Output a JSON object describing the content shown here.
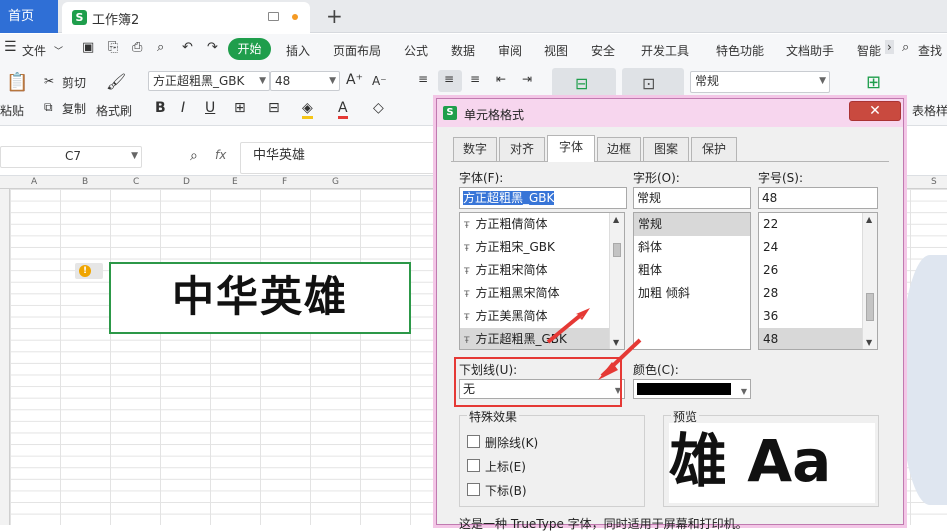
{
  "tabs": {
    "home": "首页",
    "doc": "工作簿2",
    "doc_icon": "S",
    "new": "+"
  },
  "menu": {
    "file": "文件",
    "start": "开始",
    "items": [
      "插入",
      "页面布局",
      "公式",
      "数据",
      "审阅",
      "视图",
      "安全",
      "开发工具",
      "特色功能",
      "文档助手",
      "智能"
    ],
    "search": "查找"
  },
  "ribbon": {
    "cut": "剪切",
    "copy": "复制",
    "paste": "粘贴",
    "format_painter": "格式刷",
    "font_name": "方正超粗黑_GBK",
    "font_size": "48",
    "bold": "B",
    "italic": "I",
    "underline": "U",
    "number_format": "常规",
    "table_style": "表格样"
  },
  "formula_bar": {
    "cell_ref": "C7",
    "fx": "fx",
    "content": "中华英雄"
  },
  "columns": [
    "A",
    "B",
    "C",
    "D",
    "E",
    "F",
    "G",
    "S"
  ],
  "cell_text": "中华英雄",
  "dialog": {
    "title": "单元格格式",
    "tabs": [
      "数字",
      "对齐",
      "字体",
      "边框",
      "图案",
      "保护"
    ],
    "active_tab": "字体",
    "font_label": "字体(F):",
    "font_value": "方正超粗黑_GBK",
    "font_list": [
      "方正粗倩简体",
      "方正粗宋_GBK",
      "方正粗宋简体",
      "方正粗黑宋简体",
      "方正美黑简体",
      "方正超粗黑_GBK"
    ],
    "style_label": "字形(O):",
    "style_value": "常规",
    "style_list": [
      "常规",
      "斜体",
      "粗体",
      "加粗 倾斜"
    ],
    "size_label": "字号(S):",
    "size_value": "48",
    "size_list": [
      "22",
      "24",
      "26",
      "28",
      "36",
      "48"
    ],
    "underline_label": "下划线(U):",
    "underline_value": "无",
    "color_label": "颜色(C):",
    "effects_label": "特殊效果",
    "effects": [
      "删除线(K)",
      "上标(E)",
      "下标(B)"
    ],
    "preview_label": "预览",
    "preview_text": "雄 Aa",
    "description": "这是一种 TrueType 字体，同时适用于屏幕和打印机。"
  },
  "colors": {
    "accent_green": "#1f9e4c",
    "home_blue": "#2f6fd6",
    "highlight_red": "#e53935"
  }
}
